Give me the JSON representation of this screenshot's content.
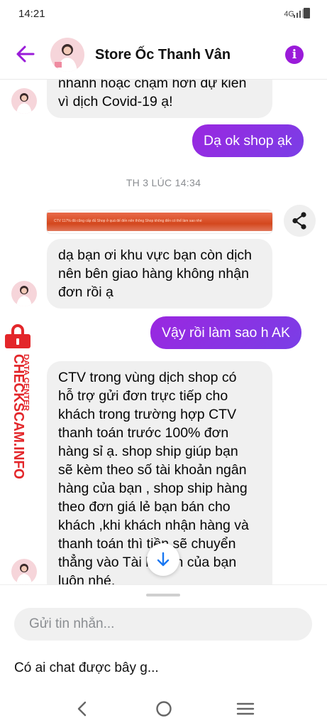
{
  "status_bar": {
    "time": "14:21",
    "network": "4G"
  },
  "header": {
    "title": "Store Ốc Thanh Vân"
  },
  "messages": {
    "m1_lines": [
      "nhanh hoặc chậm hơn dự kiến",
      "vì dịch Covid-19 ạ!"
    ],
    "m2": "Dạ ok shop ạk",
    "timestamp": "TH 3 LÚC 14:34",
    "link_preview_text": "CTV 117% đã cũng cấp đủ Shop ở quá đế đến nên thông Shop không đến có thể làm sao nhé",
    "m3_lines": [
      "dạ bạn ơi khu vực bạn còn dịch",
      "nên bên giao hàng không nhận",
      "đơn rồi ạ"
    ],
    "m4": "Vậy rồi làm sao h AK",
    "m5_lines": [
      "CTV trong vùng dịch shop có",
      "hỗ trợ gửi đơn trực tiếp cho",
      "khách trong trường hợp CTV",
      "thanh toán trước 100%  đơn",
      "hàng sỉ ạ. shop ship giúp bạn",
      "sẽ kèm theo số tài khoản ngân",
      "hàng của bạn , shop ship hàng",
      "theo đơn giá lẻ bạn bán cho",
      "khách ,khi khách nhận hàng và",
      "thanh toán thì tiền sẽ chuyển",
      "thẳng vào Tài khoản của bạn",
      "luôn nhé."
    ]
  },
  "watermark": {
    "brand": "CHECKSCAM.INFO",
    "tag": "DATA CENTER"
  },
  "composer": {
    "placeholder": "Gửi tin nhắn...",
    "suggestion": "Có ai chat được bây g..."
  },
  "icons": {
    "back": "arrow-left-icon",
    "info": "info-icon",
    "share": "share-icon",
    "scroll_down": "arrow-down-icon",
    "nav_back": "chevron-left-icon",
    "nav_home": "circle-icon",
    "nav_menu": "menu-icon"
  },
  "colors": {
    "accent": "#8e2de2",
    "incoming_bubble": "#f0f0f0",
    "watermark": "#e3262a",
    "info": "#9a1bd9"
  }
}
